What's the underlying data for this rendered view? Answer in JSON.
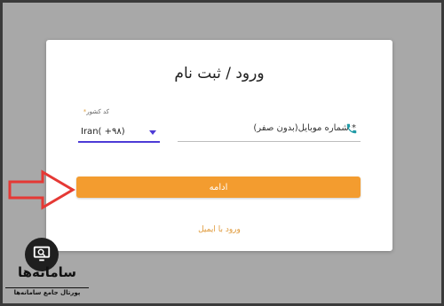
{
  "form": {
    "title": "ورود / ثبت نام",
    "country_label": "کد کشور",
    "country_required_mark": "*",
    "country_value": "Iran( +٩٨)",
    "phone_placeholder": "شماره موبایل(بدون صفر)",
    "phone_required_mark": "*",
    "continue_label": "ادامه",
    "email_login_link": "ورود با ایمیل"
  },
  "watermark": {
    "name": "سامانه‌ها",
    "tagline": "پورتال جامع سامانه‌ها"
  },
  "colors": {
    "accent_button": "#f39c2f",
    "link": "#e09b3d",
    "select_underline": "#4d3bd6",
    "phone_icon": "#1f9aa6",
    "annotation_arrow": "#e53935"
  },
  "icons": [
    "phone-icon",
    "chevron-down-icon",
    "red-arrow-icon",
    "monitor-search-icon"
  ]
}
